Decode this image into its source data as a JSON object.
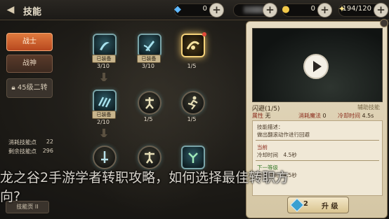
{
  "topbar": {
    "title": "技能",
    "back_icon": "back-arrow-icon",
    "gems": "0",
    "gold": "0",
    "stamina": "194/120"
  },
  "menu": {
    "warrior": "战士",
    "wargod": "战神",
    "locked": "45级二转"
  },
  "stats": {
    "consumed_label": "消耗技能点",
    "consumed_value": "22",
    "remaining_label": "剩余技能点",
    "remaining_value": "296",
    "page_button": "技能页 II"
  },
  "tree": {
    "equipped_badge": "已装备",
    "levels": [
      "3/10",
      "3/10",
      "1/5",
      "2/10",
      "1/5",
      "1/5",
      "",
      "",
      ""
    ]
  },
  "panel": {
    "skill_name": "闪避(1/5)",
    "skill_type": "辅助技能",
    "attr_label": "属性",
    "attr_value": "无",
    "mp_label": "消耗魔法",
    "mp_value": "0",
    "cd_label": "冷却时间",
    "cd_value": "4.5s",
    "desc_title": "技能描述：",
    "desc_text": "做出翻滚动作进行回避",
    "current_title": "当前",
    "current_cd": "冷却时间　4.5秒",
    "next_title": "下一等级",
    "next_text": "冷却时间　4.5秒",
    "upgrade_cost": "2",
    "upgrade_label": "升 级"
  },
  "watermark": {
    "line1": "龙之谷2手游学者转职攻略，如何选择最佳转职方",
    "line2": "向?"
  },
  "colors": {
    "accent": "#e07a3e",
    "panel": "#e7dcc3",
    "selected_glow": "#f5d27a"
  }
}
